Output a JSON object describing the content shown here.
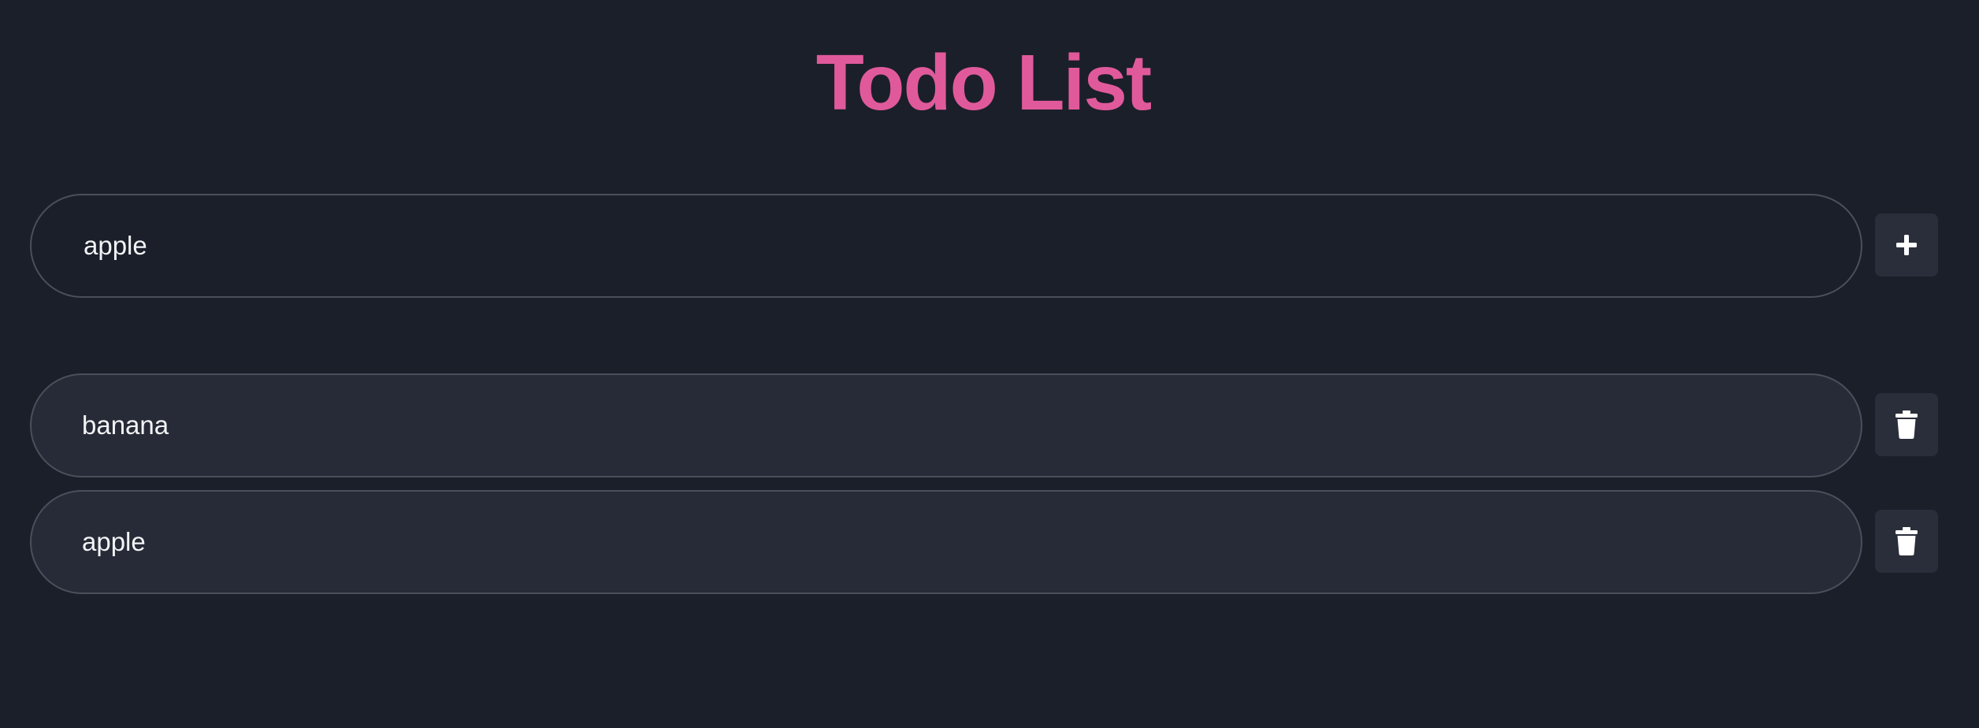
{
  "header": {
    "title": "Todo List"
  },
  "new_todo": {
    "value": "apple",
    "placeholder": ""
  },
  "add_button": {
    "icon": "plus-icon"
  },
  "todos": [
    {
      "text": "banana",
      "delete_icon": "trash-icon"
    },
    {
      "text": "apple",
      "delete_icon": "trash-icon"
    }
  ],
  "colors": {
    "background": "#1b1f2a",
    "title": "#e05a9b",
    "item_background": "#272b37",
    "border": "#4b4f5c",
    "button_background": "#2a2e3a",
    "text": "#f2f3f5"
  }
}
